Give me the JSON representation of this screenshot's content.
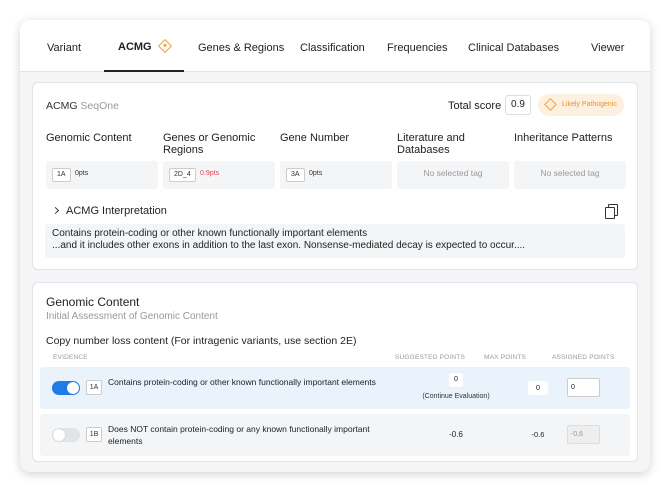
{
  "tabs": [
    {
      "label": "Variant"
    },
    {
      "label": "ACMG",
      "icon": "acmg-diamond-icon",
      "active": true
    },
    {
      "label": "Genes & Regions"
    },
    {
      "label": "Classification"
    },
    {
      "label": "Frequencies"
    },
    {
      "label": "Clinical Databases"
    },
    {
      "label": "Viewer"
    }
  ],
  "acmg": {
    "title": "ACMG",
    "title_suffix": "SeqOne",
    "total_score_label": "Total score",
    "total_score": "0.9",
    "classification": "Likely Pathogenic",
    "accent_color": "#f0a33a",
    "columns": [
      {
        "header": "Genomic Content",
        "tag": "1A",
        "points": "0pts"
      },
      {
        "header": "Genes or Genomic Regions",
        "tag": "2D_4",
        "points": "0.9pts",
        "points_color": "#e0475b"
      },
      {
        "header": "Gene Number",
        "tag": "3A",
        "points": "0pts"
      },
      {
        "header": "Literature and Databases",
        "empty_text": "No selected tag"
      },
      {
        "header": "Inheritance Patterns",
        "empty_text": "No selected tag"
      }
    ],
    "interpretation_label": "ACMG Interpretation",
    "interpretation_lines": [
      "Contains protein-coding or other known functionally important elements",
      "...and it includes other exons in addition to the last exon. Nonsense-mediated decay is expected to occur...."
    ]
  },
  "genomic_content": {
    "title": "Genomic Content",
    "subtitle": "Initial Assessment of Genomic Content",
    "section_title": "Copy number loss content (For intragenic variants, use section 2E)",
    "headers": {
      "evidence": "EVIDENCE",
      "suggested": "SUGGESTED POINTS",
      "max": "MAX POINTS",
      "assigned": "ASSIGNED POINTS"
    },
    "rows": [
      {
        "enabled": true,
        "code": "1A",
        "description": "Contains protein-coding or other known functionally important elements",
        "suggested": "0",
        "suggested_note": "(Continue Evaluation)",
        "max": "0",
        "assigned": "0"
      },
      {
        "enabled": false,
        "code": "1B",
        "description": "Does NOT contain protein-coding or any known functionally important elements",
        "suggested": "-0.6",
        "max": "-0.6",
        "assigned": "-0,6"
      }
    ],
    "toggle_on_color": "#1e7ce8"
  }
}
